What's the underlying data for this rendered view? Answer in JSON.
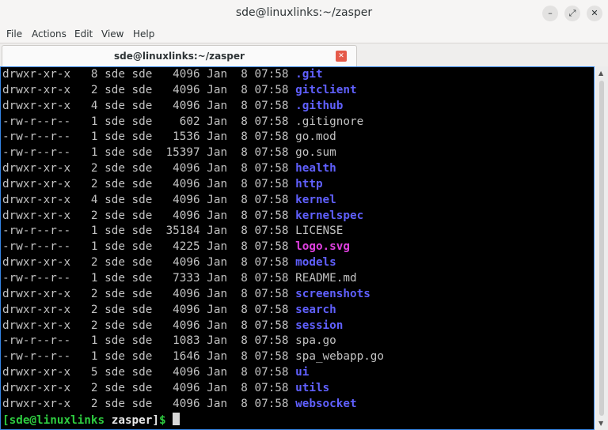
{
  "window": {
    "title": "sde@linuxlinks:~/zasper",
    "minimize_glyph": "–",
    "maximize_glyph": "⤢",
    "close_glyph": "✕"
  },
  "menu": [
    "File",
    "Actions",
    "Edit",
    "View",
    "Help"
  ],
  "tab": {
    "label": "sde@linuxlinks:~/zasper",
    "close_glyph": "✕",
    "close_color": "#e55a4a"
  },
  "colors": {
    "directory": "#6060ff",
    "regular_file": "#c2c2c2",
    "image_file": "#e040e0",
    "prompt": "#2ecc40",
    "accent": "#3584e4"
  },
  "listing": [
    {
      "perms": "drwxr-xr-x",
      "links": "8",
      "owner": "sde",
      "group": "sde",
      "size": "4096",
      "month": "Jan",
      "day": "8",
      "time": "07:58",
      "name": ".git",
      "kind": "dir"
    },
    {
      "perms": "drwxr-xr-x",
      "links": "2",
      "owner": "sde",
      "group": "sde",
      "size": "4096",
      "month": "Jan",
      "day": "8",
      "time": "07:58",
      "name": "gitclient",
      "kind": "dir"
    },
    {
      "perms": "drwxr-xr-x",
      "links": "4",
      "owner": "sde",
      "group": "sde",
      "size": "4096",
      "month": "Jan",
      "day": "8",
      "time": "07:58",
      "name": ".github",
      "kind": "dir"
    },
    {
      "perms": "-rw-r--r--",
      "links": "1",
      "owner": "sde",
      "group": "sde",
      "size": "602",
      "month": "Jan",
      "day": "8",
      "time": "07:58",
      "name": ".gitignore",
      "kind": "file"
    },
    {
      "perms": "-rw-r--r--",
      "links": "1",
      "owner": "sde",
      "group": "sde",
      "size": "1536",
      "month": "Jan",
      "day": "8",
      "time": "07:58",
      "name": "go.mod",
      "kind": "file"
    },
    {
      "perms": "-rw-r--r--",
      "links": "1",
      "owner": "sde",
      "group": "sde",
      "size": "15397",
      "month": "Jan",
      "day": "8",
      "time": "07:58",
      "name": "go.sum",
      "kind": "file"
    },
    {
      "perms": "drwxr-xr-x",
      "links": "2",
      "owner": "sde",
      "group": "sde",
      "size": "4096",
      "month": "Jan",
      "day": "8",
      "time": "07:58",
      "name": "health",
      "kind": "dir"
    },
    {
      "perms": "drwxr-xr-x",
      "links": "2",
      "owner": "sde",
      "group": "sde",
      "size": "4096",
      "month": "Jan",
      "day": "8",
      "time": "07:58",
      "name": "http",
      "kind": "dir"
    },
    {
      "perms": "drwxr-xr-x",
      "links": "4",
      "owner": "sde",
      "group": "sde",
      "size": "4096",
      "month": "Jan",
      "day": "8",
      "time": "07:58",
      "name": "kernel",
      "kind": "dir"
    },
    {
      "perms": "drwxr-xr-x",
      "links": "2",
      "owner": "sde",
      "group": "sde",
      "size": "4096",
      "month": "Jan",
      "day": "8",
      "time": "07:58",
      "name": "kernelspec",
      "kind": "dir"
    },
    {
      "perms": "-rw-r--r--",
      "links": "1",
      "owner": "sde",
      "group": "sde",
      "size": "35184",
      "month": "Jan",
      "day": "8",
      "time": "07:58",
      "name": "LICENSE",
      "kind": "file"
    },
    {
      "perms": "-rw-r--r--",
      "links": "1",
      "owner": "sde",
      "group": "sde",
      "size": "4225",
      "month": "Jan",
      "day": "8",
      "time": "07:58",
      "name": "logo.svg",
      "kind": "img"
    },
    {
      "perms": "drwxr-xr-x",
      "links": "2",
      "owner": "sde",
      "group": "sde",
      "size": "4096",
      "month": "Jan",
      "day": "8",
      "time": "07:58",
      "name": "models",
      "kind": "dir"
    },
    {
      "perms": "-rw-r--r--",
      "links": "1",
      "owner": "sde",
      "group": "sde",
      "size": "7333",
      "month": "Jan",
      "day": "8",
      "time": "07:58",
      "name": "README.md",
      "kind": "file"
    },
    {
      "perms": "drwxr-xr-x",
      "links": "2",
      "owner": "sde",
      "group": "sde",
      "size": "4096",
      "month": "Jan",
      "day": "8",
      "time": "07:58",
      "name": "screenshots",
      "kind": "dir"
    },
    {
      "perms": "drwxr-xr-x",
      "links": "2",
      "owner": "sde",
      "group": "sde",
      "size": "4096",
      "month": "Jan",
      "day": "8",
      "time": "07:58",
      "name": "search",
      "kind": "dir"
    },
    {
      "perms": "drwxr-xr-x",
      "links": "2",
      "owner": "sde",
      "group": "sde",
      "size": "4096",
      "month": "Jan",
      "day": "8",
      "time": "07:58",
      "name": "session",
      "kind": "dir"
    },
    {
      "perms": "-rw-r--r--",
      "links": "1",
      "owner": "sde",
      "group": "sde",
      "size": "1083",
      "month": "Jan",
      "day": "8",
      "time": "07:58",
      "name": "spa.go",
      "kind": "file"
    },
    {
      "perms": "-rw-r--r--",
      "links": "1",
      "owner": "sde",
      "group": "sde",
      "size": "1646",
      "month": "Jan",
      "day": "8",
      "time": "07:58",
      "name": "spa_webapp.go",
      "kind": "file"
    },
    {
      "perms": "drwxr-xr-x",
      "links": "5",
      "owner": "sde",
      "group": "sde",
      "size": "4096",
      "month": "Jan",
      "day": "8",
      "time": "07:58",
      "name": "ui",
      "kind": "dir"
    },
    {
      "perms": "drwxr-xr-x",
      "links": "2",
      "owner": "sde",
      "group": "sde",
      "size": "4096",
      "month": "Jan",
      "day": "8",
      "time": "07:58",
      "name": "utils",
      "kind": "dir"
    },
    {
      "perms": "drwxr-xr-x",
      "links": "2",
      "owner": "sde",
      "group": "sde",
      "size": "4096",
      "month": "Jan",
      "day": "8",
      "time": "07:58",
      "name": "websocket",
      "kind": "dir"
    }
  ],
  "prompt": {
    "user_host": "[sde@linuxlinks",
    "cwd": "zasper]",
    "symbol": "$"
  }
}
